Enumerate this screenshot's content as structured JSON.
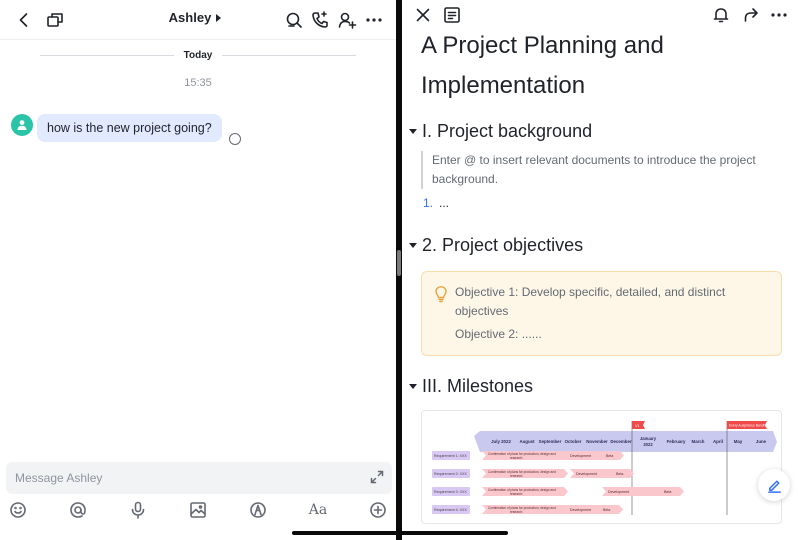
{
  "chat": {
    "title": "Ashley",
    "date_divider": "Today",
    "time": "15:35",
    "message": "how is the new project going?",
    "composer_placeholder": "Message Ashley",
    "toolbar_font_label": "Aa"
  },
  "doc": {
    "title": "A Project Planning and Implementation",
    "sections": {
      "background": {
        "heading": "I. Project background",
        "quote": "Enter @ to insert relevant documents to introduce the project background.",
        "list_number": "1.",
        "list_item": "..."
      },
      "objectives": {
        "heading": "2. Project objectives",
        "objective1": "Objective 1: Develop specific, detailed, and distinct objectives",
        "objective2": "Objective 2: ......"
      },
      "milestones": {
        "heading": "III. Milestones"
      }
    },
    "gantt": {
      "months": [
        "July 2022",
        "August",
        "September",
        "October",
        "November",
        "December",
        "January 2022",
        "February",
        "March",
        "April",
        "May",
        "June"
      ],
      "flags": [
        "V1",
        "Every Auspicious Bandha"
      ],
      "rows": [
        {
          "label": "Requirement 1: XXX",
          "tasks": [
            "Confirmation of plans for production, design and research",
            "Development",
            "Beta"
          ]
        },
        {
          "label": "Requirement 2: XXX",
          "tasks": [
            "Confirmation of plans for production, design and research",
            "Development",
            "Beta"
          ]
        },
        {
          "label": "Requirement 3: XXX",
          "tasks": [
            "Confirmation of plans for production, design and research",
            "Development",
            "Beta"
          ]
        },
        {
          "label": "Requirement 4: XXX",
          "tasks": [
            "Confirmation of plans for production, design and research",
            "Development",
            "Beta"
          ]
        }
      ]
    }
  },
  "colors": {
    "accent": "#3370ff",
    "bubble": "#e1eaff",
    "avatar": "#2bc4a8",
    "callout_bg": "#fef7e8",
    "callout_border": "#fbdcad",
    "gantt_header": "#c9c8ee",
    "gantt_label": "#d9c8f4",
    "gantt_task": "#f9c7cc",
    "gantt_flag": "#f04a4a"
  }
}
